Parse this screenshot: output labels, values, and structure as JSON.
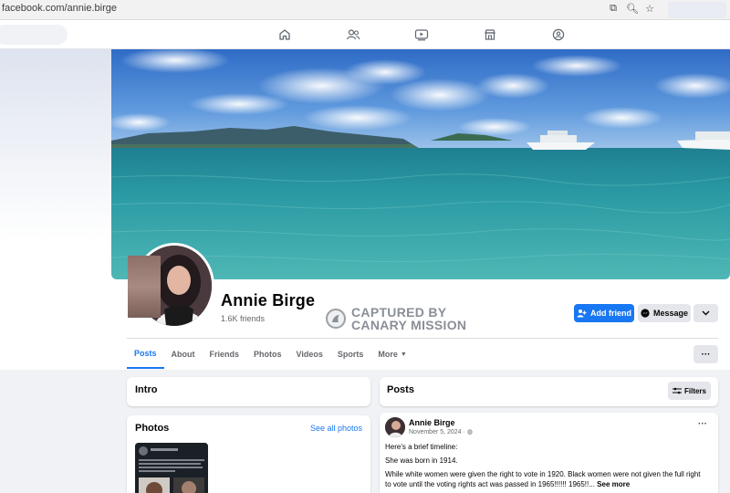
{
  "browser": {
    "url": "facebook.com/annie.birge"
  },
  "nav": {
    "icons": [
      "home-icon",
      "friends-icon",
      "video-icon",
      "marketplace-icon",
      "groups-icon"
    ]
  },
  "profile": {
    "name": "Annie Birge",
    "friends": "1.6K friends",
    "watermark_line1": "CAPTURED BY",
    "watermark_line2": "CANARY MISSION"
  },
  "actions": {
    "add_friend": "Add friend",
    "message": "Message"
  },
  "tabs": [
    "Posts",
    "About",
    "Friends",
    "Photos",
    "Videos",
    "Sports",
    "More"
  ],
  "active_tab": "Posts",
  "intro": {
    "title": "Intro"
  },
  "photos": {
    "title": "Photos",
    "see_all": "See all photos"
  },
  "posts_section": {
    "title": "Posts",
    "filters": "Filters"
  },
  "post": {
    "author": "Annie Birge",
    "date": "November 5, 2024 ·",
    "line1": "Here's a brief timeline:",
    "line2": "She was born in 1914.",
    "line3": "While white women were given the right to vote in 1920. Black women were not given the full right",
    "line4": "to vote until the voting rights act was passed in 1965!!!!!! 1965!!...",
    "see_more": "See more"
  },
  "colors": {
    "accent": "#1877f2",
    "background": "#f0f2f5"
  }
}
